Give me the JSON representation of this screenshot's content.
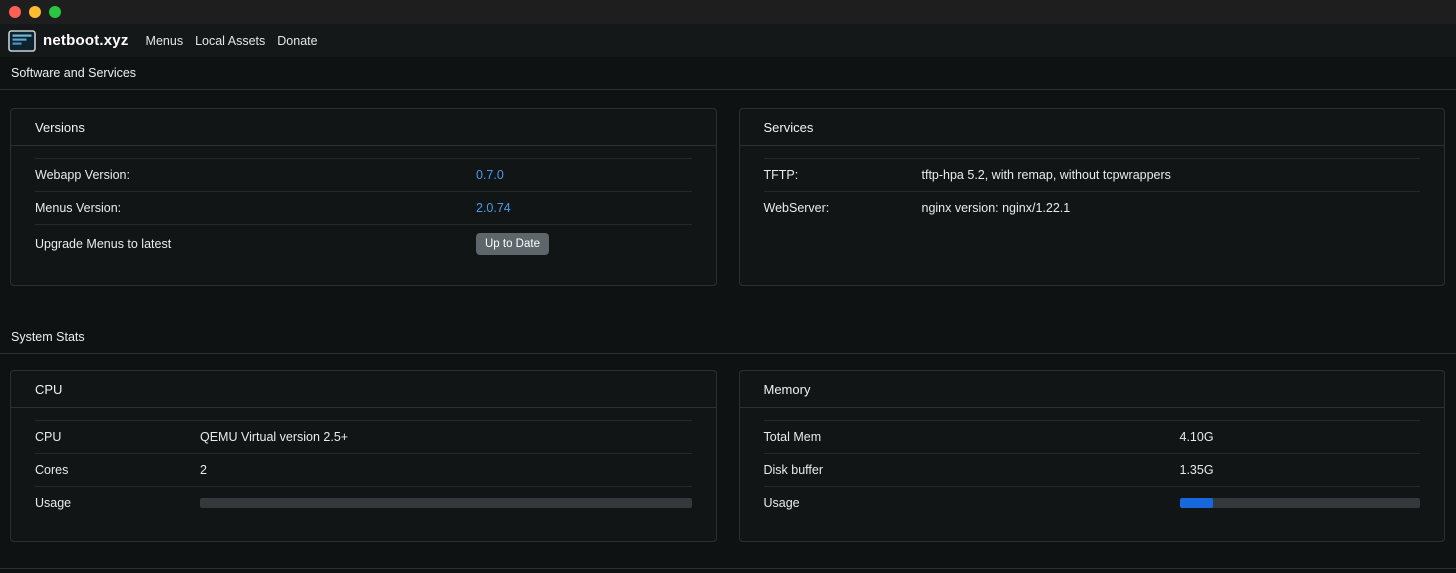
{
  "window": {
    "controls": {
      "close": "close",
      "minimize": "minimize",
      "maximize": "maximize"
    }
  },
  "navbar": {
    "brand": "netboot.xyz",
    "items": [
      {
        "label": "Menus"
      },
      {
        "label": "Local Assets"
      },
      {
        "label": "Donate"
      }
    ]
  },
  "sections": {
    "software": {
      "title": "Software and Services"
    },
    "stats": {
      "title": "System Stats"
    }
  },
  "cards": {
    "versions": {
      "title": "Versions",
      "rows": [
        {
          "label": "Webapp Version:",
          "value": "0.7.0"
        },
        {
          "label": "Menus Version:",
          "value": "2.0.74"
        },
        {
          "label": "Upgrade Menus to latest",
          "value": "Up to Date"
        }
      ]
    },
    "services": {
      "title": "Services",
      "rows": [
        {
          "label": "TFTP:",
          "value": "tftp-hpa 5.2, with remap, without tcpwrappers"
        },
        {
          "label": "WebServer:",
          "value": "nginx version: nginx/1.22.1"
        }
      ]
    },
    "cpu": {
      "title": "CPU",
      "rows": [
        {
          "label": "CPU",
          "value": "QEMU Virtual version 2.5+"
        },
        {
          "label": "Cores",
          "value": "2"
        }
      ],
      "usage": {
        "label": "Usage",
        "percent": 0
      }
    },
    "memory": {
      "title": "Memory",
      "rows": [
        {
          "label": "Total Mem",
          "value": "4.10G"
        },
        {
          "label": "Disk buffer",
          "value": "1.35G"
        }
      ],
      "usage": {
        "label": "Usage",
        "percent": 14
      }
    }
  },
  "colors": {
    "link_accent": "#4a9be6",
    "progress_fill": "#1668dc",
    "button_secondary": "#5f666b"
  }
}
